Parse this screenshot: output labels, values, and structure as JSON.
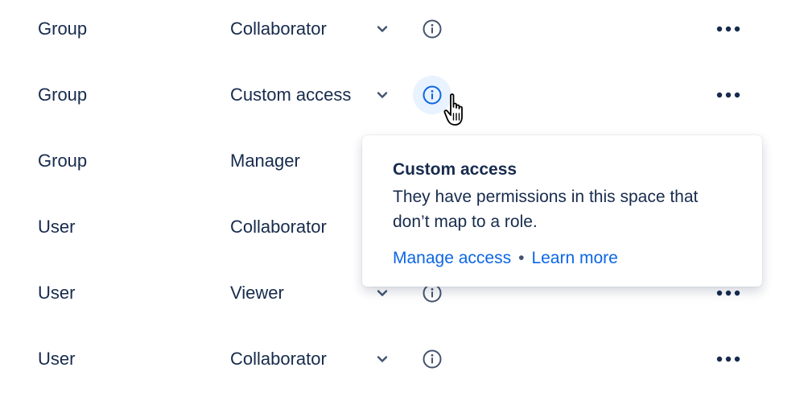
{
  "rows": [
    {
      "type": "Group",
      "role": "Collaborator"
    },
    {
      "type": "Group",
      "role": "Custom access"
    },
    {
      "type": "Group",
      "role": "Manager"
    },
    {
      "type": "User",
      "role": "Collaborator"
    },
    {
      "type": "User",
      "role": "Viewer"
    },
    {
      "type": "User",
      "role": "Collaborator"
    }
  ],
  "popover": {
    "title": "Custom access",
    "body": "They have permissions in this space that don’t map to a role.",
    "manage_link": "Manage access",
    "separator": "•",
    "learn_link": "Learn more"
  },
  "icons": {
    "chevron": "chevron-down-icon",
    "info": "info-icon",
    "more": "more-horizontal-icon",
    "cursor": "hand-pointer-cursor"
  },
  "colors": {
    "text": "#172B4D",
    "link": "#0C66E4",
    "info_active_bg": "#E9F2FF",
    "info_active_icon": "#0C66E4",
    "icon": "#44546F"
  }
}
